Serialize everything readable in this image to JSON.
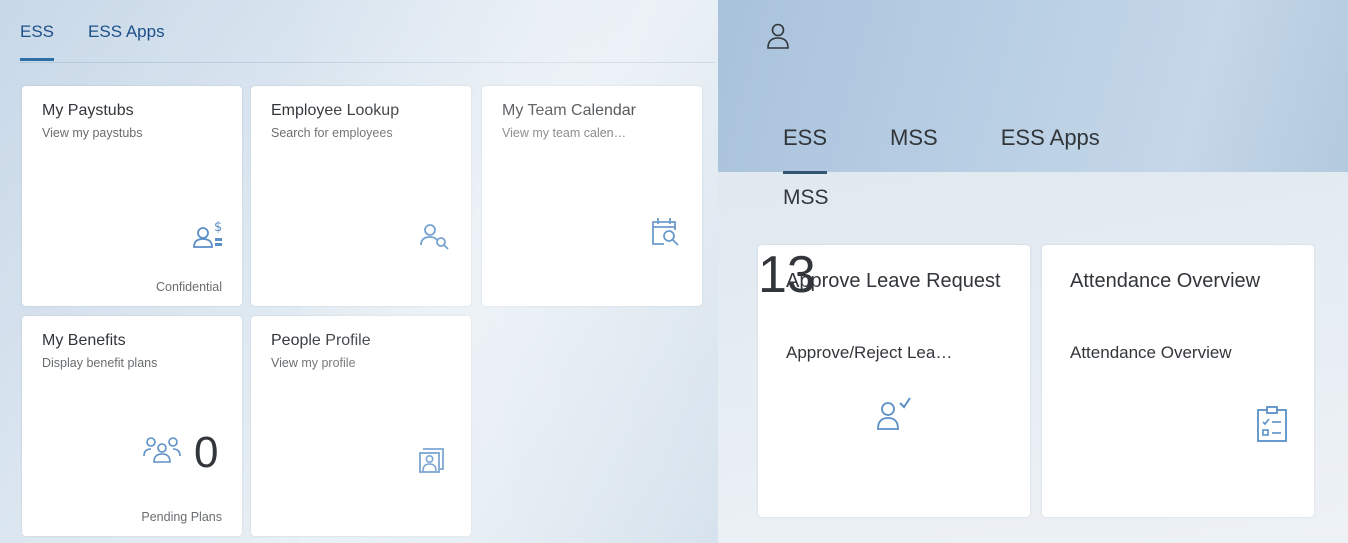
{
  "left": {
    "tabs": [
      {
        "label": "ESS",
        "active": true
      },
      {
        "label": "ESS Apps",
        "active": false
      }
    ],
    "tiles": [
      {
        "title": "My Paystubs",
        "subtitle": "View my paystubs",
        "icon": "paystub-icon",
        "footer": "Confidential"
      },
      {
        "title": "Employee Lookup",
        "subtitle": "Search for employees",
        "icon": "person-search-icon"
      },
      {
        "title": "My Team Calendar",
        "subtitle": "View my team calen…",
        "icon": "calendar-search-icon"
      },
      {
        "title": "My Benefits",
        "subtitle": "Display benefit plans",
        "icon": "group-icon",
        "number": "0",
        "footer": "Pending Plans"
      },
      {
        "title": "People Profile",
        "subtitle": "View my profile",
        "icon": "profile-card-icon"
      }
    ]
  },
  "right": {
    "user_icon": "user-icon",
    "tabs": [
      {
        "label": "ESS",
        "active": true
      },
      {
        "label": "MSS",
        "active": false
      },
      {
        "label": "ESS Apps",
        "active": false
      }
    ],
    "section_title": "MSS",
    "tiles": [
      {
        "title": "Approve Leave Request",
        "subtitle": "Approve/Reject Lea…",
        "icon": "person-approve-icon",
        "number": "13"
      },
      {
        "title": "Attendance Overview",
        "subtitle": "Attendance Overview",
        "icon": "checklist-icon"
      }
    ]
  },
  "colors": {
    "accent": "#2c6ea8",
    "icon": "#5b8fc7",
    "tile_bg": "#ffffff"
  }
}
